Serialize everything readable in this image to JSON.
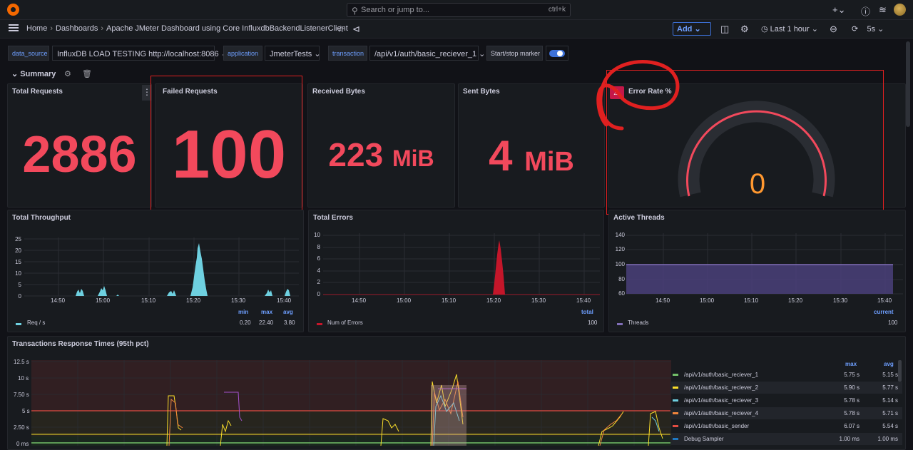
{
  "topbar": {
    "search_placeholder": "Search or jump to...",
    "search_shortcut": "ctrl+k"
  },
  "navbar": {
    "breadcrumbs": [
      "Home",
      "Dashboards",
      "Apache JMeter Dashboard using Core InfluxdbBackendListenerClient"
    ],
    "add_label": "Add",
    "time_range": "Last 1 hour",
    "refresh_interval": "5s"
  },
  "variables": {
    "data_source": {
      "label": "data_source",
      "value": "InfluxDB LOAD TESTING http://localhost:8086"
    },
    "application": {
      "label": "application",
      "value": "JmeterTests"
    },
    "transaction": {
      "label": "transaction",
      "value": "/api/v1/auth/basic_reciever_1"
    },
    "marker_label": "Start/stop marker",
    "marker_on": true
  },
  "row": {
    "title": "Summary"
  },
  "stats": {
    "total_requests": {
      "title": "Total Requests",
      "value": "2886"
    },
    "failed_requests": {
      "title": "Failed Requests",
      "value": "100"
    },
    "received_bytes": {
      "title": "Received Bytes",
      "value": "223",
      "unit": "MiB"
    },
    "sent_bytes": {
      "title": "Sent Bytes",
      "value": "4",
      "unit": "MiB"
    },
    "error_rate": {
      "title": "Error Rate %",
      "value": "0"
    }
  },
  "colors": {
    "stat_red": "#f2495c",
    "gauge_orange": "#ff9830",
    "throughput": "#6ed0e0",
    "errors": "#c4162a",
    "threads": "#806eb7",
    "accent_blue": "#6e9fff"
  },
  "throughput": {
    "title": "Total Throughput",
    "y_ticks": [
      "25",
      "20",
      "15",
      "10",
      "5",
      "0"
    ],
    "x_ticks": [
      "14:50",
      "15:00",
      "15:10",
      "15:20",
      "15:30",
      "15:40"
    ],
    "legend_headers": [
      "min",
      "max",
      "avg"
    ],
    "series_name": "Req / s",
    "min": "0.20",
    "max": "22.40",
    "avg": "3.80"
  },
  "errors": {
    "title": "Total Errors",
    "y_ticks": [
      "10",
      "8",
      "6",
      "4",
      "2",
      "0"
    ],
    "x_ticks": [
      "14:50",
      "15:00",
      "15:10",
      "15:20",
      "15:30",
      "15:40"
    ],
    "legend_header": "total",
    "series_name": "Num of Errors",
    "total": "100"
  },
  "threads": {
    "title": "Active Threads",
    "y_ticks": [
      "140",
      "120",
      "100",
      "80",
      "60"
    ],
    "x_ticks": [
      "14:50",
      "15:00",
      "15:10",
      "15:20",
      "15:30",
      "15:40"
    ],
    "legend_header": "current",
    "series_name": "Threads",
    "current": "100"
  },
  "response_times": {
    "title": "Transactions Response Times (95th pct)",
    "y_ticks": [
      "12.5 s",
      "10 s",
      "7.50 s",
      "5 s",
      "2.50 s",
      "0 ms"
    ],
    "headers": {
      "max": "max",
      "avg": "avg"
    },
    "rows": [
      {
        "name": "/api/v1/auth/basic_reciever_1",
        "max": "5.75 s",
        "avg": "5.15 s",
        "color": "#73bf69"
      },
      {
        "name": "/api/v1/auth/basic_reciever_2",
        "max": "5.90 s",
        "avg": "5.77 s",
        "color": "#fade2a"
      },
      {
        "name": "/api/v1/auth/basic_reciever_3",
        "max": "5.78 s",
        "avg": "5.14 s",
        "color": "#6ed0e0"
      },
      {
        "name": "/api/v1/auth/basic_reciever_4",
        "max": "5.78 s",
        "avg": "5.71 s",
        "color": "#ef843c"
      },
      {
        "name": "/api/v1/auth/basic_sender",
        "max": "6.07 s",
        "avg": "5.54 s",
        "color": "#e24d42"
      },
      {
        "name": "Debug Sampler",
        "max": "1.00 ms",
        "avg": "1.00 ms",
        "color": "#1f78c1"
      }
    ]
  }
}
